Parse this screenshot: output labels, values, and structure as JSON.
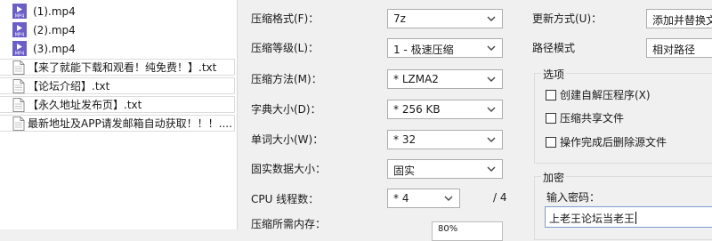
{
  "files": [
    {
      "name": "(1).mp4",
      "type": "mp4"
    },
    {
      "name": "(2).mp4",
      "type": "mp4"
    },
    {
      "name": "(3).mp4",
      "type": "mp4"
    },
    {
      "name": "【来了就能下载和观看！纯免费！】.txt",
      "type": "txt"
    },
    {
      "name": "【论坛介绍】.txt",
      "type": "txt"
    },
    {
      "name": "【永久地址发布页】.txt",
      "type": "txt"
    },
    {
      "name": "最新地址及APP请发邮箱自动获取！！！....",
      "type": "txt"
    }
  ],
  "icons": {
    "mp4": "mp4-file-icon",
    "txt": "text-file-icon",
    "dropdown": "chevron-down-icon"
  },
  "colors": {
    "mp4_icon": "#6b5fc7",
    "field_border": "#adadad",
    "focus_border": "#7a9ccf"
  },
  "settings": {
    "format_label": "压缩格式(F)：",
    "format_value": "7z",
    "level_label": "压缩等级(L)：",
    "level_value": "1 - 极速压缩",
    "method_label": "压缩方法(M)：",
    "method_value": "* LZMA2",
    "dict_label": "字典大小(D)：",
    "dict_value": "* 256 KB",
    "word_label": "单词大小(W)：",
    "word_value": "* 32",
    "solid_label": "固实数据大小：",
    "solid_value": "固实",
    "threads_label": "CPU 线程数：",
    "threads_value": "* 4",
    "threads_total": "/ 4",
    "memory_label": "压缩所需内存：",
    "memory_value": "80%",
    "update_label": "更新方式(U)：",
    "update_value": "添加并替换文",
    "path_label": "路径模式",
    "path_value": "相对路径",
    "options_title": "选项",
    "opt_sfx": "创建自解压程序(X)",
    "opt_shared": "压缩共享文件",
    "opt_delete": "操作完成后删除源文件",
    "encrypt_title": "加密",
    "password_label": "输入密码：",
    "password_value": "上老王论坛当老王"
  }
}
